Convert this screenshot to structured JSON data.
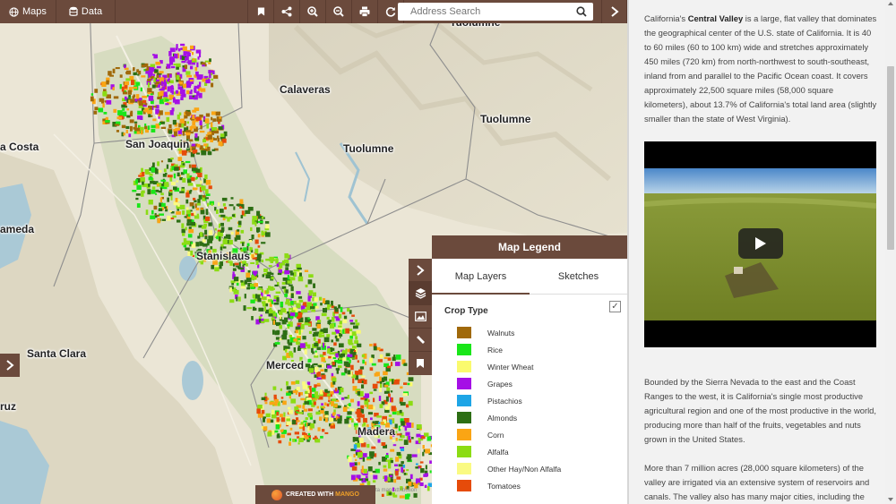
{
  "toolbar": {
    "maps_label": "Maps",
    "data_label": "Data",
    "icons": [
      "bookmark-icon",
      "share-icon",
      "zoom-in-icon",
      "zoom-out-icon",
      "print-icon",
      "refresh-icon"
    ],
    "search_placeholder": "Address Search",
    "color": "#6b4a3c"
  },
  "map": {
    "labels": {
      "tuolumne_top": "Tuolumne",
      "calaveras": "Calaveras",
      "tuolumne_county": "Tuolumne",
      "tuolumne_city": "Tuolumne",
      "contra_costa": "a Costa",
      "san_joaquin": "San Joaquin",
      "alameda": "ameda",
      "stanislaus": "Stanislaus",
      "santa_clara": "Santa Clara",
      "merced": "Merced",
      "cruz": "ruz",
      "madera": "Madera"
    }
  },
  "legend": {
    "title": "Map Legend",
    "tabs": [
      "Map Layers",
      "Sketches"
    ],
    "active_tab": "Map Layers",
    "layer_title": "Crop Type",
    "layer_checked": true,
    "check_mark": "✓",
    "tools": [
      "chevron-right-icon",
      "layers-icon",
      "image-icon",
      "ruler-icon",
      "bookmark-icon"
    ],
    "items": [
      {
        "label": "Walnuts",
        "color": "#a0690a"
      },
      {
        "label": "Rice",
        "color": "#19e619"
      },
      {
        "label": "Winter Wheat",
        "color": "#fafa6e"
      },
      {
        "label": "Grapes",
        "color": "#a50fe6"
      },
      {
        "label": "Pistachios",
        "color": "#1ea5e6"
      },
      {
        "label": "Almonds",
        "color": "#2d6e14"
      },
      {
        "label": "Corn",
        "color": "#faa514"
      },
      {
        "label": "Alfalfa",
        "color": "#8cdc14"
      },
      {
        "label": "Other Hay/Non Alfalfa",
        "color": "#fafa82"
      },
      {
        "label": "Tomatoes",
        "color": "#e64b0a"
      }
    ]
  },
  "credit": {
    "created_with": "CREATED WITH",
    "brand": "MANGO",
    "attribution": "ta map attribution"
  },
  "panel": {
    "p1_before": "California's ",
    "p1_bold": "Central Valley",
    "p1_after": " is a large, flat valley that dominates the geographical center of the U.S. state of California. It is 40 to 60 miles (60 to 100 km) wide and stretches approximately 450 miles (720 km) from north-northwest to south-southeast, inland from and parallel to the Pacific Ocean coast. It covers approximately 22,500 square miles (58,000 square kilometers), about 13.7% of California's total land area (slightly smaller than the state of West Virginia).",
    "p2": "Bounded by the Sierra Nevada to the east and the Coast Ranges to the west, it is California's single most productive agricultural region and one of the most productive in the world, producing more than half of the fruits, vegetables and nuts grown in the United States.",
    "p3": "More than 7 million acres (28,000 square kilometers) of the valley are irrigated via an extensive system of reservoirs and canals. The valley also has many major cities, including the"
  }
}
